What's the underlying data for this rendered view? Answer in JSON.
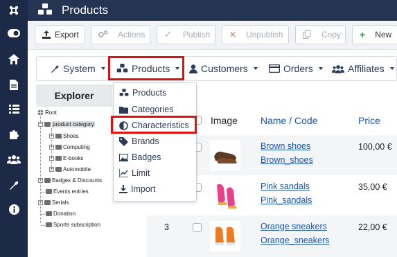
{
  "header": {
    "title": "Products"
  },
  "toolbar": {
    "export": "Export",
    "actions": "Actions",
    "publish": "Publish",
    "unpublish": "Unpublish",
    "copy": "Copy",
    "new": "New"
  },
  "menu": {
    "system": "System",
    "products": "Products",
    "customers": "Customers",
    "orders": "Orders",
    "affiliates": "Affiliates"
  },
  "dropdown": {
    "items": [
      "Products",
      "Categories",
      "Characteristics",
      "Brands",
      "Badges",
      "Limit",
      "Import"
    ]
  },
  "explorer": {
    "title": "Explorer",
    "root": "Root",
    "category": "product category",
    "children": [
      "Shoes",
      "Computing",
      "E-books",
      "Automobile"
    ],
    "others": [
      "Badges & Discounts",
      "Events entries",
      "Serials",
      "Donation",
      "Sports subscription"
    ]
  },
  "table": {
    "columns": {
      "image": "Image",
      "name": "Name / Code",
      "price": "Price"
    },
    "rows": [
      {
        "num": "",
        "name": "Brown shoes",
        "code": "Brown_shoes",
        "price": "100,00 €"
      },
      {
        "num": "",
        "name": "Pink sandals",
        "code": "Pink_sandals",
        "price": "35,00 €"
      },
      {
        "num": "3",
        "name": "Orange sneakers",
        "code": "Orange_sneakers",
        "price": "22,00 €"
      }
    ]
  },
  "colors": {
    "sidebar": "#1c2a48",
    "topbar": "#253452",
    "accent_link": "#1a55a8",
    "highlight": "#e01010"
  }
}
